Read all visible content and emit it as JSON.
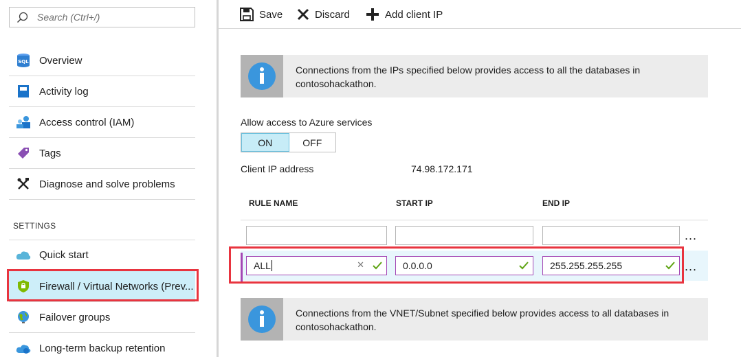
{
  "search": {
    "placeholder": "Search (Ctrl+/)"
  },
  "sidebar": {
    "items": [
      {
        "label": "Overview",
        "icon": "sql-database-icon"
      },
      {
        "label": "Activity log",
        "icon": "activity-log-icon"
      },
      {
        "label": "Access control (IAM)",
        "icon": "people-icon"
      },
      {
        "label": "Tags",
        "icon": "tag-icon"
      },
      {
        "label": "Diagnose and solve problems",
        "icon": "wrench-icon"
      }
    ],
    "settings_label": "SETTINGS",
    "settings_items": [
      {
        "label": "Quick start",
        "icon": "cloud-icon"
      },
      {
        "label": "Firewall / Virtual Networks (Prev...",
        "icon": "shield-icon"
      },
      {
        "label": "Failover groups",
        "icon": "globe-icon"
      },
      {
        "label": "Long-term backup retention",
        "icon": "cloud-backup-icon"
      }
    ]
  },
  "toolbar": {
    "save_label": "Save",
    "discard_label": "Discard",
    "add_client_ip_label": "Add client IP"
  },
  "info_top": {
    "text_line1": "Connections from the IPs specified below provides access to all the databases in",
    "text_line2": "contosohackathon."
  },
  "azure_access": {
    "label": "Allow access to Azure services",
    "on_label": "ON",
    "off_label": "OFF",
    "selected": "ON"
  },
  "client_ip": {
    "label": "Client IP address",
    "value": "74.98.172.171"
  },
  "rules_table": {
    "headers": [
      "RULE NAME",
      "START IP",
      "END IP"
    ],
    "new_row": {
      "rule_name": "",
      "start_ip": "",
      "end_ip": ""
    },
    "rows": [
      {
        "rule_name": "ALL",
        "start_ip": "0.0.0.0",
        "end_ip": "255.255.255.255"
      }
    ],
    "more_label": "..."
  },
  "info_bottom": {
    "text_line1": "Connections from the VNET/Subnet specified below provides access to all databases in",
    "text_line2": "contosohackathon."
  },
  "colors": {
    "accent": "#0078d7",
    "highlight_red": "#e8343f",
    "active_bg": "#cdeef9",
    "valid_green": "#5ea312",
    "edit_purple": "#a347b5"
  }
}
